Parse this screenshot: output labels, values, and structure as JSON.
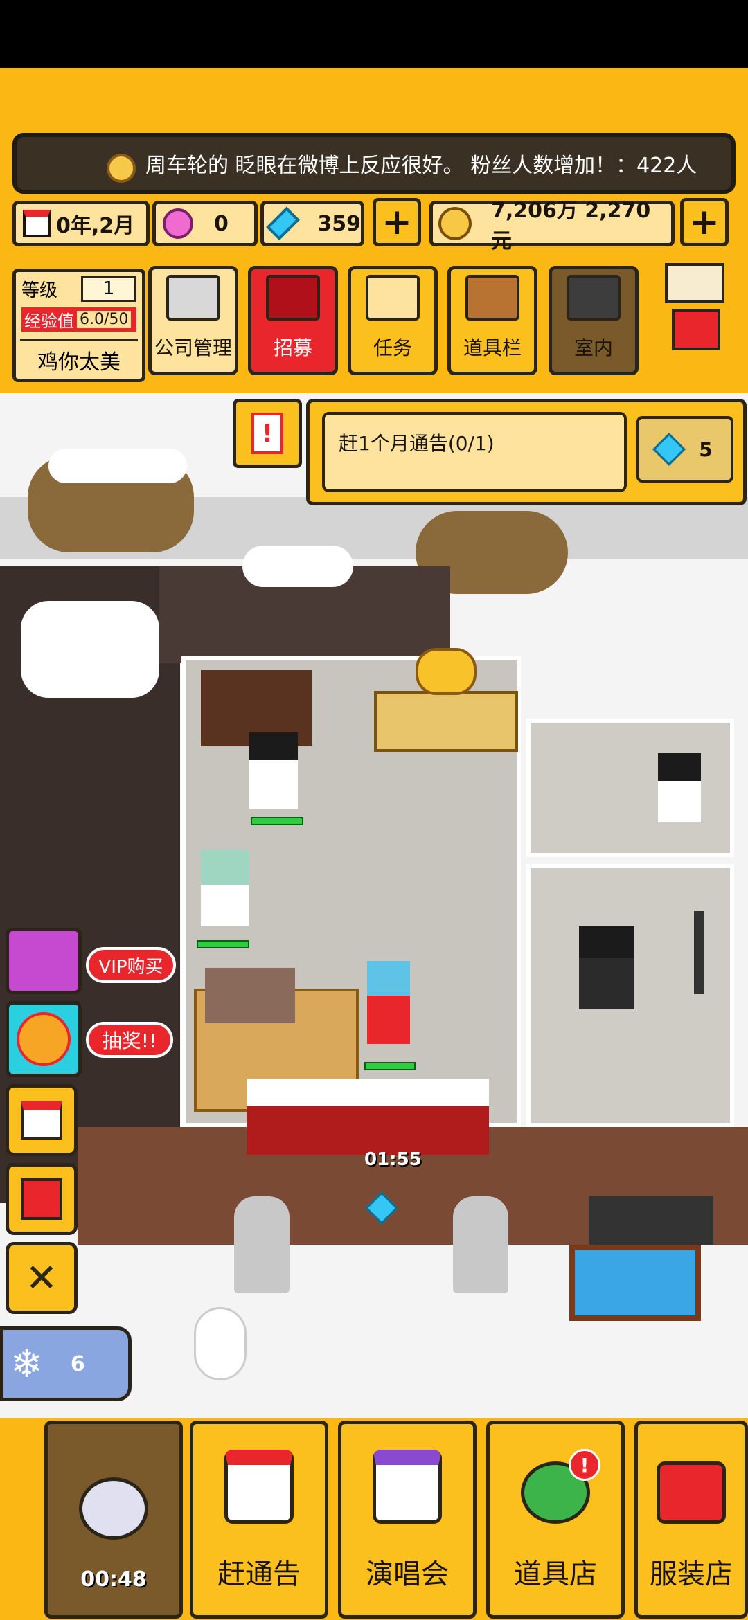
{
  "news_ticker": "周车轮的 眨眼在微博上反应很好。 粉丝人数增加！：422人",
  "resources": {
    "date": "0年,2月",
    "pink_gems": "0",
    "diamonds": "359",
    "money": "7,206万 2,270元"
  },
  "player": {
    "level_label": "等级",
    "level": "1",
    "exp_label": "经验值",
    "exp": "6.0/50",
    "name": "鸡你太美"
  },
  "menu": [
    {
      "label": "公司管理",
      "icon": "building-icon"
    },
    {
      "label": "招募",
      "icon": "megaphone-icon"
    },
    {
      "label": "任务",
      "icon": "scroll-icon"
    },
    {
      "label": "道具栏",
      "icon": "chest-icon"
    },
    {
      "label": "室内",
      "icon": "paint-roller-icon"
    }
  ],
  "quest": {
    "text": "赶1个月通告(0/1)",
    "reward": "5"
  },
  "side": {
    "vip": "VIP购买",
    "lottery": "抽奖!!",
    "snow_count": "6"
  },
  "scene": {
    "timer": "01:55"
  },
  "bottom_nav": [
    {
      "label": "00:48",
      "icon": "disc-icon"
    },
    {
      "label": "赶通告",
      "icon": "calendar-icon"
    },
    {
      "label": "演唱会",
      "icon": "rainbow-stage-icon"
    },
    {
      "label": "道具店",
      "icon": "clover-icon"
    },
    {
      "label": "服装店",
      "icon": "shirt-icon"
    }
  ],
  "colors": {
    "accent": "#fbb714",
    "recruit_active": "#e8262c"
  }
}
